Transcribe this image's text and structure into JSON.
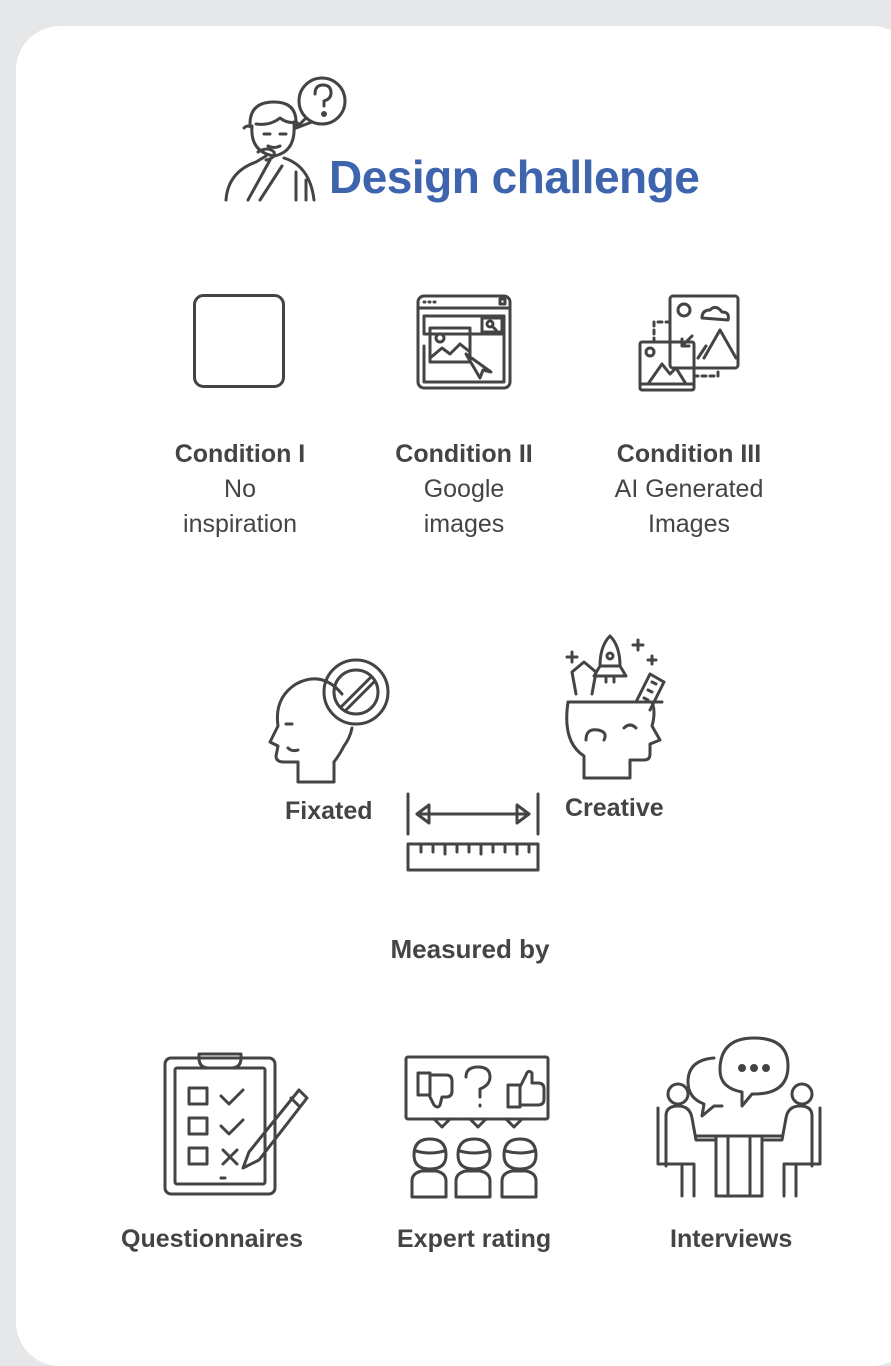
{
  "title": "Design challenge",
  "accent_color": "#3d64ad",
  "conditions": [
    {
      "heading": "Condition I",
      "sub1": "No",
      "sub2": "inspiration",
      "icon": "blank-square-icon"
    },
    {
      "heading": "Condition II",
      "sub1": "Google",
      "sub2": "images",
      "icon": "browser-image-search-icon"
    },
    {
      "heading": "Condition III",
      "sub1": "AI Generated",
      "sub2": "Images",
      "icon": "ai-images-icon"
    }
  ],
  "scale": {
    "left": "Fixated",
    "right": "Creative"
  },
  "measured_by": "Measured by",
  "methods": [
    {
      "label": "Questionnaires",
      "icon": "clipboard-checklist-icon"
    },
    {
      "label": "Expert rating",
      "icon": "expert-panel-icon"
    },
    {
      "label": "Interviews",
      "icon": "interview-table-icon"
    }
  ]
}
